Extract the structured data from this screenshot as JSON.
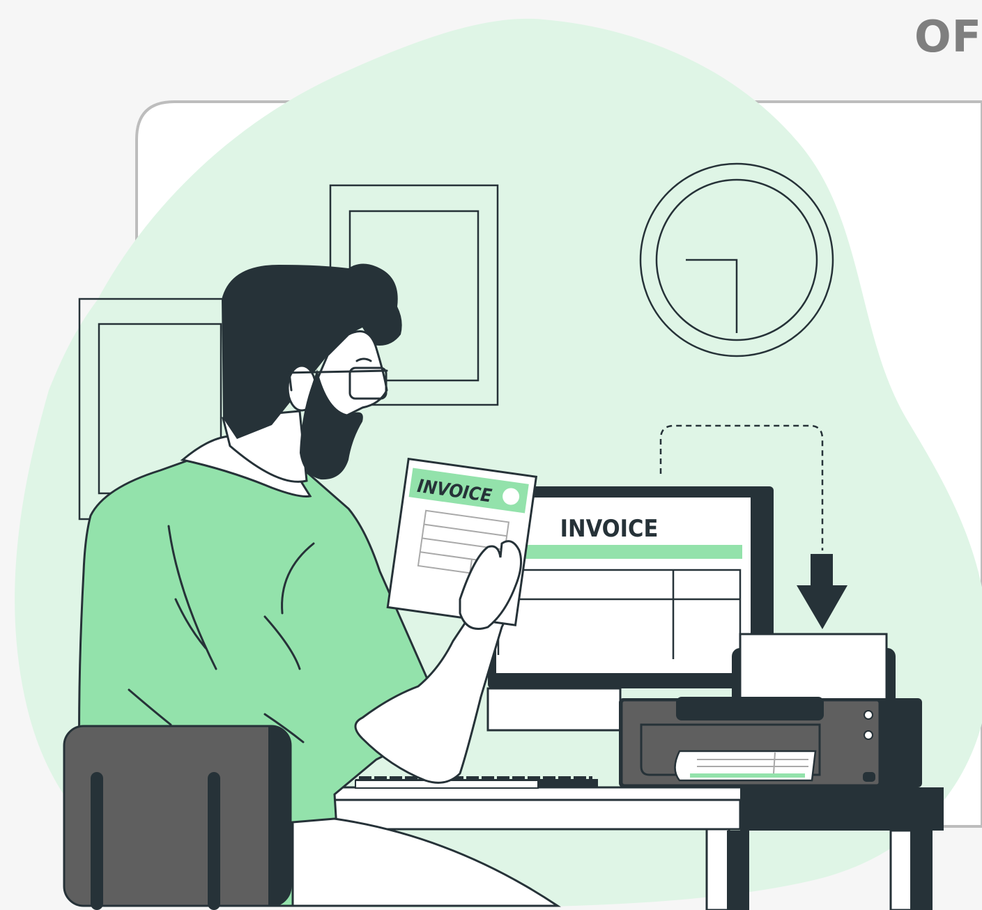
{
  "corner_text": "OF",
  "monitor": {
    "heading": "INVOICE"
  },
  "paper": {
    "heading": "INVOICE"
  },
  "colors": {
    "background": "#f6f6f6",
    "blob": "#dff5e6",
    "accent_green": "#93e2ab",
    "ink": "#263238",
    "printer_gray": "#5f5f5f",
    "white": "#ffffff"
  },
  "icons": [
    "clock-icon",
    "down-arrow-icon",
    "printer-icon"
  ]
}
